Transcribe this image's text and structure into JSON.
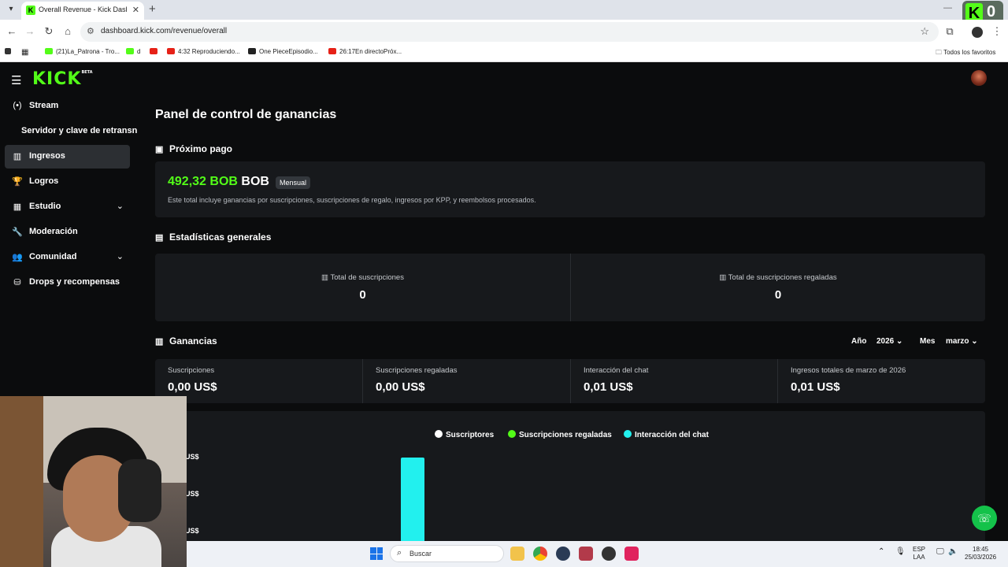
{
  "browser": {
    "tab_title": "Overall Revenue - Kick Dashbo",
    "new_tab": "+",
    "url": "dashboard.kick.com/revenue/overall",
    "bookmarks": [
      {
        "label": "(21)La_Patrona - Tro...",
        "color": "#53fc18"
      },
      {
        "label": "d",
        "color": "#53fc18"
      },
      {
        "label": "",
        "color": "#e62117"
      },
      {
        "label": "4:32 Reproduciendo...",
        "color": "#e62117"
      },
      {
        "label": "One PieceEpisodio...",
        "color": "#222222"
      },
      {
        "label": "26:17En directoPróx...",
        "color": "#e62117"
      }
    ],
    "all_favorites": "Todos los favoritos",
    "overlay_count": "0"
  },
  "app": {
    "logo": "KICK",
    "logo_beta": "BETA",
    "accent": "#53fc18",
    "sidebar": [
      {
        "label": "Stream",
        "icon": "broadcast-icon",
        "glyph": "(•)",
        "chevron": false,
        "active": false
      },
      {
        "label": "Servidor y clave de retransn",
        "icon": "",
        "glyph": "",
        "chevron": false,
        "active": false
      },
      {
        "label": "Ingresos",
        "icon": "bar-chart-icon",
        "glyph": "▥",
        "chevron": false,
        "active": true
      },
      {
        "label": "Logros",
        "icon": "trophy-icon",
        "glyph": "🏆",
        "chevron": false,
        "active": false
      },
      {
        "label": "Estudio",
        "icon": "studio-icon",
        "glyph": "▦",
        "chevron": true,
        "active": false
      },
      {
        "label": "Moderación",
        "icon": "wrench-icon",
        "glyph": "🔧",
        "chevron": false,
        "active": false
      },
      {
        "label": "Comunidad",
        "icon": "community-icon",
        "glyph": "👥",
        "chevron": true,
        "active": false
      },
      {
        "label": "Drops y recompensas",
        "icon": "drops-icon",
        "glyph": "⛁",
        "chevron": false,
        "active": false
      }
    ],
    "page_title": "Panel de control de ganancias",
    "next_payment": {
      "title": "Próximo pago",
      "amount": "492,32 BOB",
      "currency": "BOB",
      "badge": "Mensual",
      "description": "Este total incluye ganancias por suscripciones, suscripciones de regalo, ingresos por KPP, y reembolsos procesados."
    },
    "general_stats": {
      "title": "Estadísticas generales",
      "items": [
        {
          "label": "Total de suscripciones",
          "value": "0"
        },
        {
          "label": "Total de suscripciones regaladas",
          "value": "0"
        }
      ]
    },
    "earnings": {
      "title": "Ganancias",
      "year_label": "Año",
      "year_value": "2026",
      "month_label": "Mes",
      "month_value": "marzo",
      "cells": [
        {
          "label": "Suscripciones",
          "value": "0,00 US$"
        },
        {
          "label": "Suscripciones regaladas",
          "value": "0,00 US$"
        },
        {
          "label": "Interacción del chat",
          "value": "0,01 US$"
        },
        {
          "label": "Ingresos totales de marzo de 2026",
          "value": "0,01 US$"
        }
      ]
    }
  },
  "chart_data": {
    "type": "bar",
    "series": [
      {
        "name": "Suscriptores",
        "color": "#ffffff",
        "values": []
      },
      {
        "name": "Suscripciones regaladas",
        "color": "#53fc18",
        "values": []
      },
      {
        "name": "Interacción del chat",
        "color": "#22f0ee",
        "values": [
          0.01
        ]
      }
    ],
    "tick_labels": [
      "US$",
      "US$",
      "US$"
    ]
  },
  "taskbar": {
    "search": "Buscar",
    "lang": "ESP",
    "layout": "LAA",
    "time": "18:45",
    "date": "25/03/2026"
  }
}
